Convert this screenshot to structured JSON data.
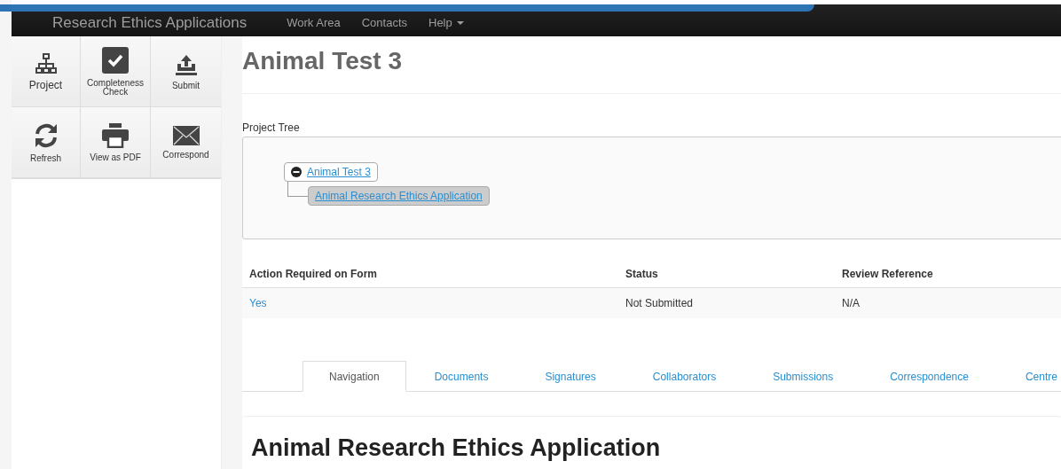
{
  "navbar": {
    "brand": "Research Ethics Applications",
    "links": [
      {
        "label": "Work Area",
        "dropdown": false
      },
      {
        "label": "Contacts",
        "dropdown": false
      },
      {
        "label": "Help",
        "dropdown": true
      }
    ]
  },
  "toolbar": [
    {
      "label": "Project",
      "kind": "tree"
    },
    {
      "label": "Completeness Check",
      "kind": "check"
    },
    {
      "label": "Submit",
      "kind": "upload"
    },
    {
      "label": "Refresh",
      "kind": "refresh"
    },
    {
      "label": "View as PDF",
      "kind": "print"
    },
    {
      "label": "Correspond",
      "kind": "mail"
    }
  ],
  "page_title": "Animal Test 3",
  "project_tree": {
    "label": "Project Tree",
    "root": {
      "label": "Animal Test 3",
      "expanded": true,
      "selected": false,
      "children": [
        {
          "label": "Animal Research Ethics Application",
          "selected": true
        }
      ]
    }
  },
  "table": {
    "columns": [
      "Action Required on Form",
      "Status",
      "Review Reference"
    ],
    "rows": [
      [
        "Yes",
        "Not Submitted",
        "N/A"
      ]
    ]
  },
  "tabs": [
    {
      "label": "Navigation",
      "selected": true
    },
    {
      "label": "Documents",
      "selected": false
    },
    {
      "label": "Signatures",
      "selected": false
    },
    {
      "label": "Collaborators",
      "selected": false
    },
    {
      "label": "Submissions",
      "selected": false
    },
    {
      "label": "Correspondence",
      "selected": false
    },
    {
      "label": "Centre",
      "selected": false
    }
  ],
  "section_title": "Animal Research Ethics Application"
}
